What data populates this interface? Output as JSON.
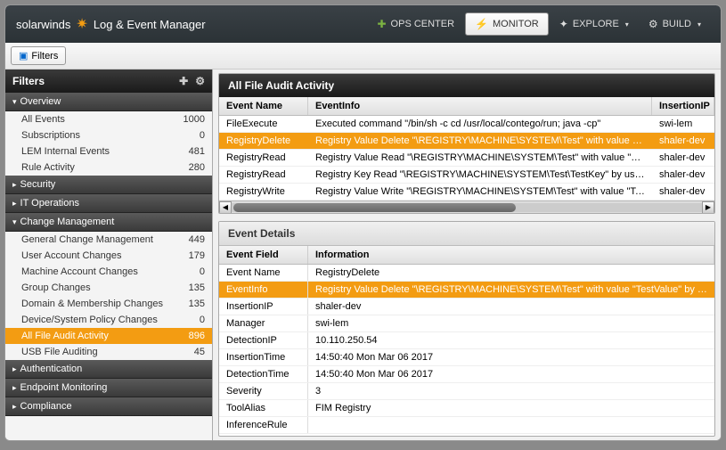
{
  "product": "Log & Event Manager",
  "brand": "solarwinds",
  "nav": [
    {
      "label": "OPS CENTER",
      "caret": ""
    },
    {
      "label": "MONITOR",
      "caret": ""
    },
    {
      "label": "EXPLORE",
      "caret": "▾"
    },
    {
      "label": "BUILD",
      "caret": "▾"
    }
  ],
  "filters_btn": "Filters",
  "sidebar": {
    "title": "Filters",
    "cats": [
      {
        "label": "Overview",
        "open": true,
        "items": [
          {
            "label": "All Events",
            "count": "1000"
          },
          {
            "label": "Subscriptions",
            "count": "0"
          },
          {
            "label": "LEM Internal Events",
            "count": "481"
          },
          {
            "label": "Rule Activity",
            "count": "280"
          }
        ]
      },
      {
        "label": "Security",
        "open": false
      },
      {
        "label": "IT Operations",
        "open": false
      },
      {
        "label": "Change Management",
        "open": true,
        "items": [
          {
            "label": "General Change Management",
            "count": "449"
          },
          {
            "label": "User Account Changes",
            "count": "179"
          },
          {
            "label": "Machine Account Changes",
            "count": "0"
          },
          {
            "label": "Group Changes",
            "count": "135"
          },
          {
            "label": "Domain & Membership Changes",
            "count": "135"
          },
          {
            "label": "Device/System Policy Changes",
            "count": "0"
          },
          {
            "label": "All File Audit Activity",
            "count": "896",
            "sel": true
          },
          {
            "label": "USB File Auditing",
            "count": "45"
          }
        ]
      },
      {
        "label": "Authentication",
        "open": false
      },
      {
        "label": "Endpoint Monitoring",
        "open": false
      },
      {
        "label": "Compliance",
        "open": false
      }
    ]
  },
  "grid": {
    "title": "All File Audit Activity",
    "cols": [
      "Event Name",
      "EventInfo",
      "InsertionIP"
    ],
    "rows": [
      {
        "name": "FileExecute",
        "info": "Executed command \"/bin/sh -c cd /usr/local/contego/run; java -cp\"",
        "ip": "swi-lem"
      },
      {
        "name": "RegistryDelete",
        "info": "Registry Value Delete \"\\REGISTRY\\MACHINE\\SYSTEM\\Test\" with value \"TestValue\"",
        "ip": "shaler-dev",
        "sel": true
      },
      {
        "name": "RegistryRead",
        "info": "Registry Value Read \"\\REGISTRY\\MACHINE\\SYSTEM\\Test\" with value \"TestValue\"",
        "ip": "shaler-dev"
      },
      {
        "name": "RegistryRead",
        "info": "Registry Key Read \"\\REGISTRY\\MACHINE\\SYSTEM\\Test\\TestKey\" by user \"admin\"",
        "ip": "shaler-dev"
      },
      {
        "name": "RegistryWrite",
        "info": "Registry Value Write \"\\REGISTRY\\MACHINE\\SYSTEM\\Test\" with value \"TestValue\" l",
        "ip": "shaler-dev"
      }
    ]
  },
  "details": {
    "title": "Event Details",
    "cols": [
      "Event Field",
      "Information"
    ],
    "rows": [
      {
        "f": "Event Name",
        "v": "RegistryDelete"
      },
      {
        "f": "EventInfo",
        "v": "Registry Value Delete \"\\REGISTRY\\MACHINE\\SYSTEM\\Test\" with value \"TestValue\" by user \"admin\"",
        "sel": true
      },
      {
        "f": "InsertionIP",
        "v": "shaler-dev"
      },
      {
        "f": "Manager",
        "v": "swi-lem"
      },
      {
        "f": "DetectionIP",
        "v": "10.110.250.54"
      },
      {
        "f": "InsertionTime",
        "v": "14:50:40 Mon Mar 06 2017"
      },
      {
        "f": "DetectionTime",
        "v": "14:50:40 Mon Mar 06 2017"
      },
      {
        "f": "Severity",
        "v": "3"
      },
      {
        "f": "ToolAlias",
        "v": "FIM Registry"
      },
      {
        "f": "InferenceRule",
        "v": ""
      }
    ]
  }
}
